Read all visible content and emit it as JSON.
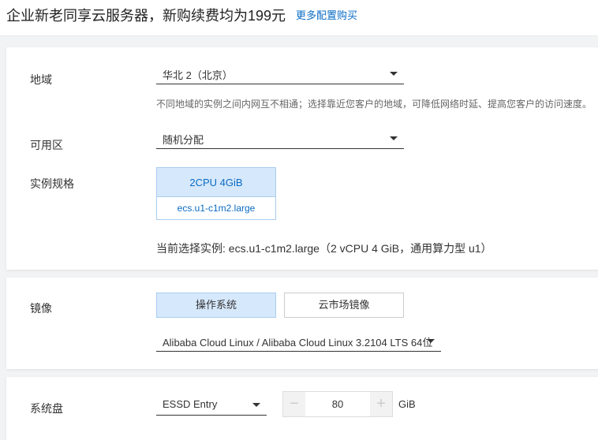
{
  "header": {
    "title": "企业新老同享云服务器，新购续费均为199元",
    "more_link": "更多配置购买"
  },
  "region": {
    "label": "地域",
    "value": "华北 2（北京）",
    "hint": "不同地域的实例之间内网互不相通；选择靠近您客户的地域，可降低网络时延、提高您客户的访问速度。"
  },
  "zone": {
    "label": "可用区",
    "value": "随机分配"
  },
  "instance": {
    "label": "实例规格",
    "spec": "2CPU 4GiB",
    "type": "ecs.u1-c1m2.large",
    "current": "当前选择实例: ecs.u1-c1m2.large（2 vCPU 4 GiB，通用算力型 u1）"
  },
  "image": {
    "label": "镜像",
    "tabs": [
      "操作系统",
      "云市场镜像"
    ],
    "value": "Alibaba Cloud Linux / Alibaba Cloud Linux 3.2104 LTS 64位"
  },
  "disk": {
    "label": "系统盘",
    "type": "ESSD Entry",
    "minus": "−",
    "size": "80",
    "plus": "+",
    "unit": "GiB"
  }
}
